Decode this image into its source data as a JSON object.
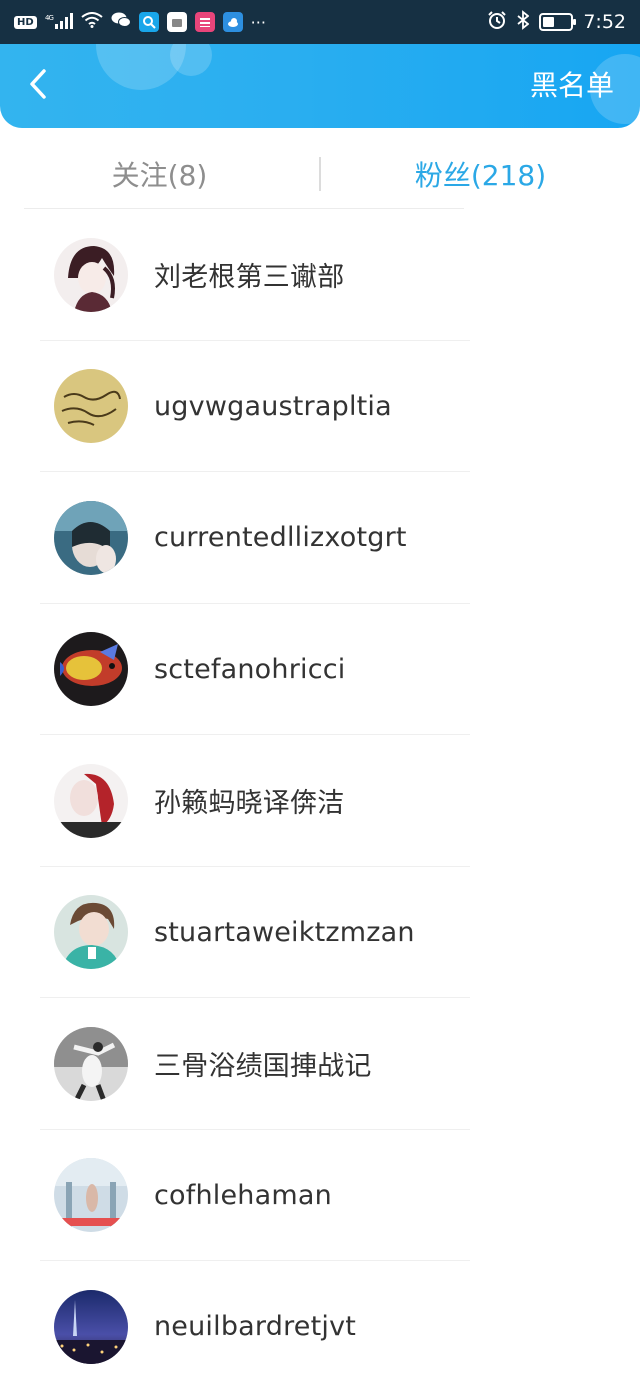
{
  "status_bar": {
    "hd_badge": "HD",
    "network": "4G",
    "time": "7:52",
    "more": "···",
    "icons": [
      "hd-icon",
      "signal-icon",
      "wifi-icon",
      "wechat-icon",
      "search-app-icon",
      "taobao-app-icon",
      "weather-app-icon",
      "alarm-icon",
      "bluetooth-icon",
      "battery-icon"
    ]
  },
  "header": {
    "blacklist_label": "黑名单",
    "back_icon": "chevron-left-icon",
    "accent": "#2aaef0"
  },
  "tabs": [
    {
      "label": "关注(8)",
      "active": false
    },
    {
      "label": "粉丝(218)",
      "active": true
    }
  ],
  "active_color": "#2ba8e6",
  "fans": [
    {
      "name": "刘老根第三谳部"
    },
    {
      "name": "ugvwgaustrapltia"
    },
    {
      "name": "currentedllizxotgrt"
    },
    {
      "name": "sctefanohricci"
    },
    {
      "name": "孙籁蚂晓译倴洁"
    },
    {
      "name": "stuartaweiktzmzan"
    },
    {
      "name": "三骨浴绩国捙战记"
    },
    {
      "name": "cofhlehaman"
    },
    {
      "name": "neuilbardretjvt"
    }
  ]
}
